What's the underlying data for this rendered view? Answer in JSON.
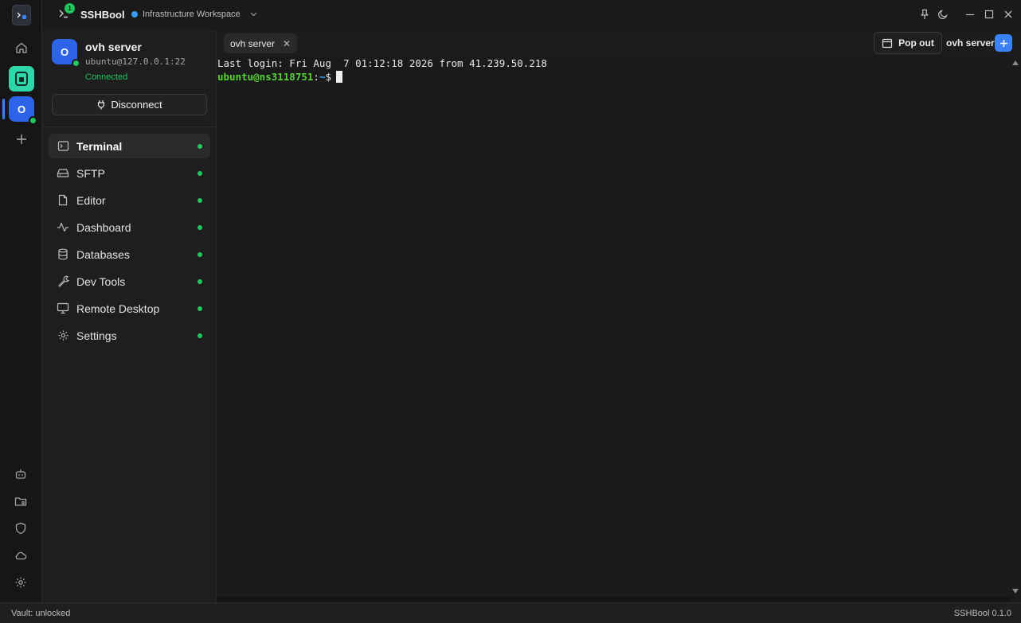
{
  "app": {
    "title": "SSHBool",
    "badge": "1",
    "workspace": "Infrastructure Workspace"
  },
  "rail": {
    "server_initial": "O"
  },
  "connection": {
    "avatar_initial": "O",
    "name": "ovh server",
    "address": "ubuntu@127.0.0.1:22",
    "status": "Connected",
    "disconnect_label": "Disconnect"
  },
  "nav": [
    {
      "label": "Terminal",
      "icon": "terminal-icon"
    },
    {
      "label": "SFTP",
      "icon": "hard-drive-icon"
    },
    {
      "label": "Editor",
      "icon": "file-icon"
    },
    {
      "label": "Dashboard",
      "icon": "activity-icon"
    },
    {
      "label": "Databases",
      "icon": "database-icon"
    },
    {
      "label": "Dev Tools",
      "icon": "wrench-icon"
    },
    {
      "label": "Remote Desktop",
      "icon": "monitor-icon"
    },
    {
      "label": "Settings",
      "icon": "gear-icon"
    }
  ],
  "tabs": {
    "active_tab": "ovh server",
    "popout_label": "Pop out",
    "server_label": "ovh server"
  },
  "terminal": {
    "line1": "Last login: Fri Aug  7 01:12:18 2026 from 41.239.50.218",
    "prompt_user": "ubuntu@ns3118751",
    "prompt_sep": ":",
    "prompt_path": "~",
    "prompt_symbol": "$"
  },
  "statusbar": {
    "left": "Vault: unlocked",
    "right": "SSHBool 0.1.0"
  },
  "colors": {
    "accent": "#3b82f6",
    "success": "#22c55e",
    "brand": "#2ed6a8"
  }
}
